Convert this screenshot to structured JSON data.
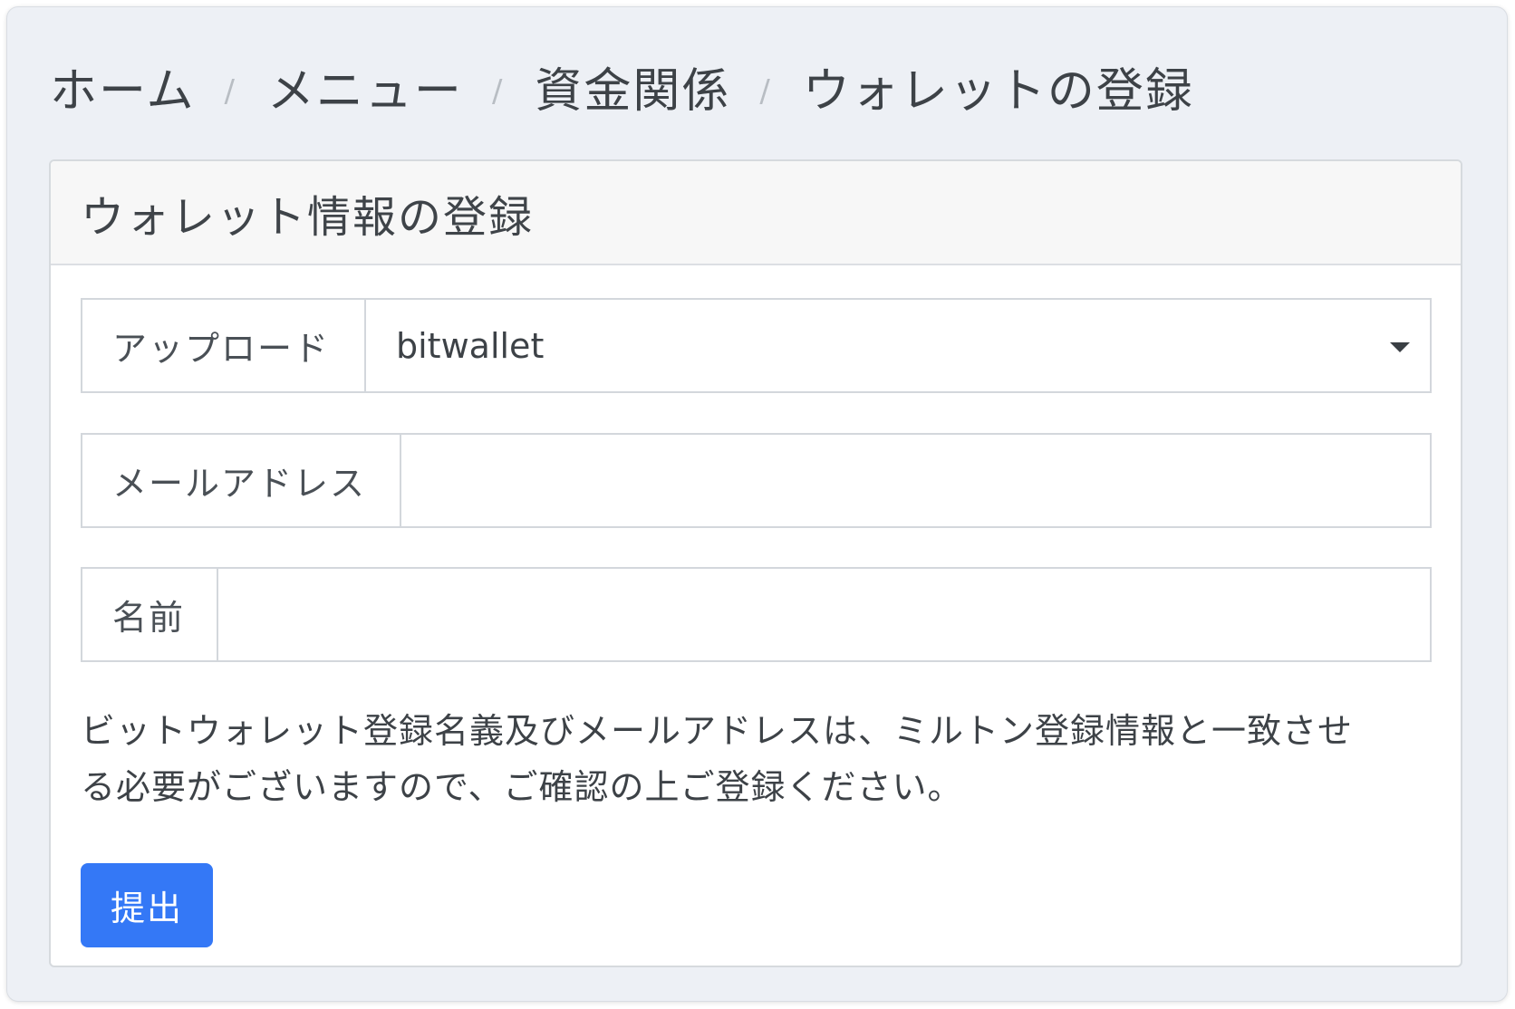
{
  "breadcrumb": {
    "items": [
      "ホーム",
      "メニュー",
      "資金関係",
      "ウォレットの登録"
    ],
    "separator": "/"
  },
  "card": {
    "title": "ウォレット情報の登録"
  },
  "form": {
    "upload": {
      "label": "アップロード",
      "selected": "bitwallet",
      "icon": "chevron-down-icon"
    },
    "email": {
      "label": "メールアドレス",
      "value": ""
    },
    "name": {
      "label": "名前",
      "value": ""
    },
    "note_line1": "ビットウォレット登録名義及びメールアドレスは、ミルトン登録情報と一致させ",
    "note_line2": "る必要がございますので、ご確認の上ご登録ください。",
    "submit_label": "提出"
  },
  "colors": {
    "background": "#edf0f5",
    "card_header": "#f7f7f7",
    "border": "#d3d7dc",
    "primary_button": "#3478f6",
    "text": "#3d4247"
  }
}
